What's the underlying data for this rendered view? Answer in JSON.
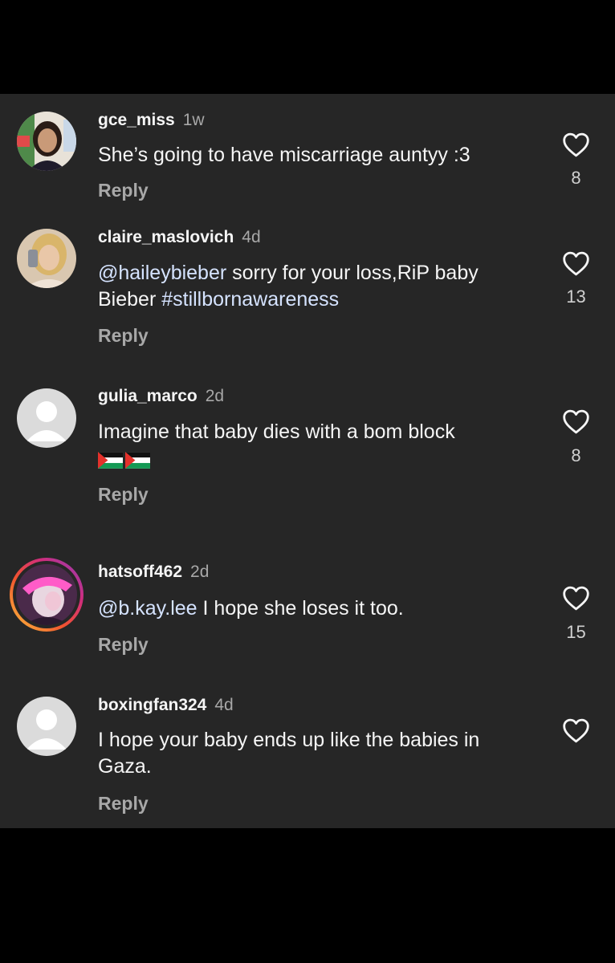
{
  "comments": [
    {
      "username": "gce_miss",
      "time": "1w",
      "text_plain": "She’s going to have miscarriage auntyy :3",
      "reply_label": "Reply",
      "likes": "8",
      "avatar": "photo"
    },
    {
      "username": "claire_maslovich",
      "time": "4d",
      "mention": "@haileybieber",
      "text_rest": " sorry for your loss,RiP baby Bieber ",
      "hashtag": "#stillbornawareness",
      "reply_label": "Reply",
      "likes": "13",
      "avatar": "photo"
    },
    {
      "username": "gulia_marco",
      "time": "2d",
      "text_plain": "Imagine that baby dies with a bom block",
      "emoji": [
        "palestine-flag",
        "palestine-flag"
      ],
      "reply_label": "Reply",
      "likes": "8",
      "avatar": "default"
    },
    {
      "username": "hatsoff462",
      "time": "2d",
      "mention": "@b.kay.lee",
      "text_rest": " I hope she loses it too.",
      "reply_label": "Reply",
      "likes": "15",
      "avatar": "story-ring-photo"
    },
    {
      "username": "boxingfan324",
      "time": "4d",
      "text_plain": "I hope your baby ends up like the babies in Gaza.",
      "reply_label": "Reply",
      "likes": "",
      "avatar": "default"
    }
  ],
  "colors": {
    "background": "#000000",
    "panel": "#262626",
    "text": "#f5f5f5",
    "muted": "#a8a8a8",
    "mention": "#d5e3ff"
  }
}
